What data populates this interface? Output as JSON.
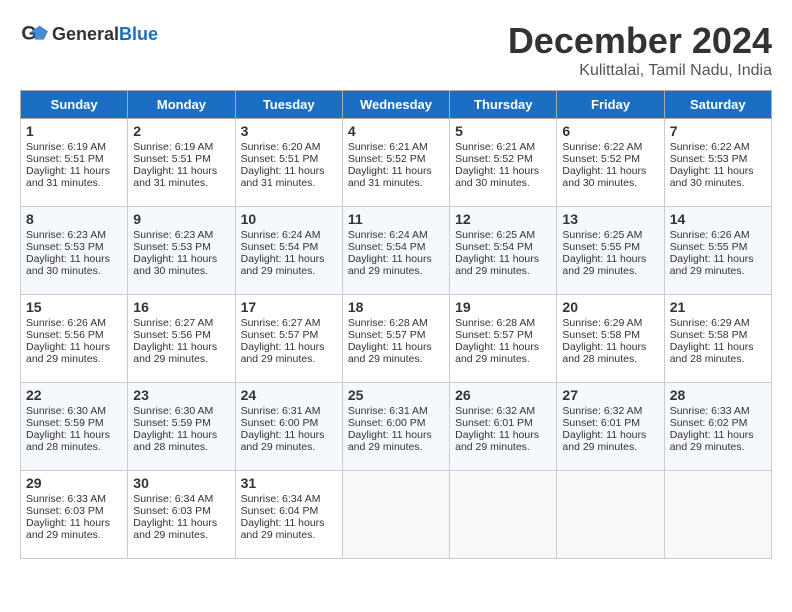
{
  "header": {
    "logo_general": "General",
    "logo_blue": "Blue",
    "month": "December 2024",
    "location": "Kulittalai, Tamil Nadu, India"
  },
  "weekdays": [
    "Sunday",
    "Monday",
    "Tuesday",
    "Wednesday",
    "Thursday",
    "Friday",
    "Saturday"
  ],
  "weeks": [
    [
      {
        "day": "1",
        "sunrise": "6:19 AM",
        "sunset": "5:51 PM",
        "daylight": "11 hours and 31 minutes."
      },
      {
        "day": "2",
        "sunrise": "6:19 AM",
        "sunset": "5:51 PM",
        "daylight": "11 hours and 31 minutes."
      },
      {
        "day": "3",
        "sunrise": "6:20 AM",
        "sunset": "5:51 PM",
        "daylight": "11 hours and 31 minutes."
      },
      {
        "day": "4",
        "sunrise": "6:21 AM",
        "sunset": "5:52 PM",
        "daylight": "11 hours and 31 minutes."
      },
      {
        "day": "5",
        "sunrise": "6:21 AM",
        "sunset": "5:52 PM",
        "daylight": "11 hours and 30 minutes."
      },
      {
        "day": "6",
        "sunrise": "6:22 AM",
        "sunset": "5:52 PM",
        "daylight": "11 hours and 30 minutes."
      },
      {
        "day": "7",
        "sunrise": "6:22 AM",
        "sunset": "5:53 PM",
        "daylight": "11 hours and 30 minutes."
      }
    ],
    [
      {
        "day": "8",
        "sunrise": "6:23 AM",
        "sunset": "5:53 PM",
        "daylight": "11 hours and 30 minutes."
      },
      {
        "day": "9",
        "sunrise": "6:23 AM",
        "sunset": "5:53 PM",
        "daylight": "11 hours and 30 minutes."
      },
      {
        "day": "10",
        "sunrise": "6:24 AM",
        "sunset": "5:54 PM",
        "daylight": "11 hours and 29 minutes."
      },
      {
        "day": "11",
        "sunrise": "6:24 AM",
        "sunset": "5:54 PM",
        "daylight": "11 hours and 29 minutes."
      },
      {
        "day": "12",
        "sunrise": "6:25 AM",
        "sunset": "5:54 PM",
        "daylight": "11 hours and 29 minutes."
      },
      {
        "day": "13",
        "sunrise": "6:25 AM",
        "sunset": "5:55 PM",
        "daylight": "11 hours and 29 minutes."
      },
      {
        "day": "14",
        "sunrise": "6:26 AM",
        "sunset": "5:55 PM",
        "daylight": "11 hours and 29 minutes."
      }
    ],
    [
      {
        "day": "15",
        "sunrise": "6:26 AM",
        "sunset": "5:56 PM",
        "daylight": "11 hours and 29 minutes."
      },
      {
        "day": "16",
        "sunrise": "6:27 AM",
        "sunset": "5:56 PM",
        "daylight": "11 hours and 29 minutes."
      },
      {
        "day": "17",
        "sunrise": "6:27 AM",
        "sunset": "5:57 PM",
        "daylight": "11 hours and 29 minutes."
      },
      {
        "day": "18",
        "sunrise": "6:28 AM",
        "sunset": "5:57 PM",
        "daylight": "11 hours and 29 minutes."
      },
      {
        "day": "19",
        "sunrise": "6:28 AM",
        "sunset": "5:57 PM",
        "daylight": "11 hours and 29 minutes."
      },
      {
        "day": "20",
        "sunrise": "6:29 AM",
        "sunset": "5:58 PM",
        "daylight": "11 hours and 28 minutes."
      },
      {
        "day": "21",
        "sunrise": "6:29 AM",
        "sunset": "5:58 PM",
        "daylight": "11 hours and 28 minutes."
      }
    ],
    [
      {
        "day": "22",
        "sunrise": "6:30 AM",
        "sunset": "5:59 PM",
        "daylight": "11 hours and 28 minutes."
      },
      {
        "day": "23",
        "sunrise": "6:30 AM",
        "sunset": "5:59 PM",
        "daylight": "11 hours and 28 minutes."
      },
      {
        "day": "24",
        "sunrise": "6:31 AM",
        "sunset": "6:00 PM",
        "daylight": "11 hours and 29 minutes."
      },
      {
        "day": "25",
        "sunrise": "6:31 AM",
        "sunset": "6:00 PM",
        "daylight": "11 hours and 29 minutes."
      },
      {
        "day": "26",
        "sunrise": "6:32 AM",
        "sunset": "6:01 PM",
        "daylight": "11 hours and 29 minutes."
      },
      {
        "day": "27",
        "sunrise": "6:32 AM",
        "sunset": "6:01 PM",
        "daylight": "11 hours and 29 minutes."
      },
      {
        "day": "28",
        "sunrise": "6:33 AM",
        "sunset": "6:02 PM",
        "daylight": "11 hours and 29 minutes."
      }
    ],
    [
      {
        "day": "29",
        "sunrise": "6:33 AM",
        "sunset": "6:03 PM",
        "daylight": "11 hours and 29 minutes."
      },
      {
        "day": "30",
        "sunrise": "6:34 AM",
        "sunset": "6:03 PM",
        "daylight": "11 hours and 29 minutes."
      },
      {
        "day": "31",
        "sunrise": "6:34 AM",
        "sunset": "6:04 PM",
        "daylight": "11 hours and 29 minutes."
      },
      null,
      null,
      null,
      null
    ]
  ]
}
